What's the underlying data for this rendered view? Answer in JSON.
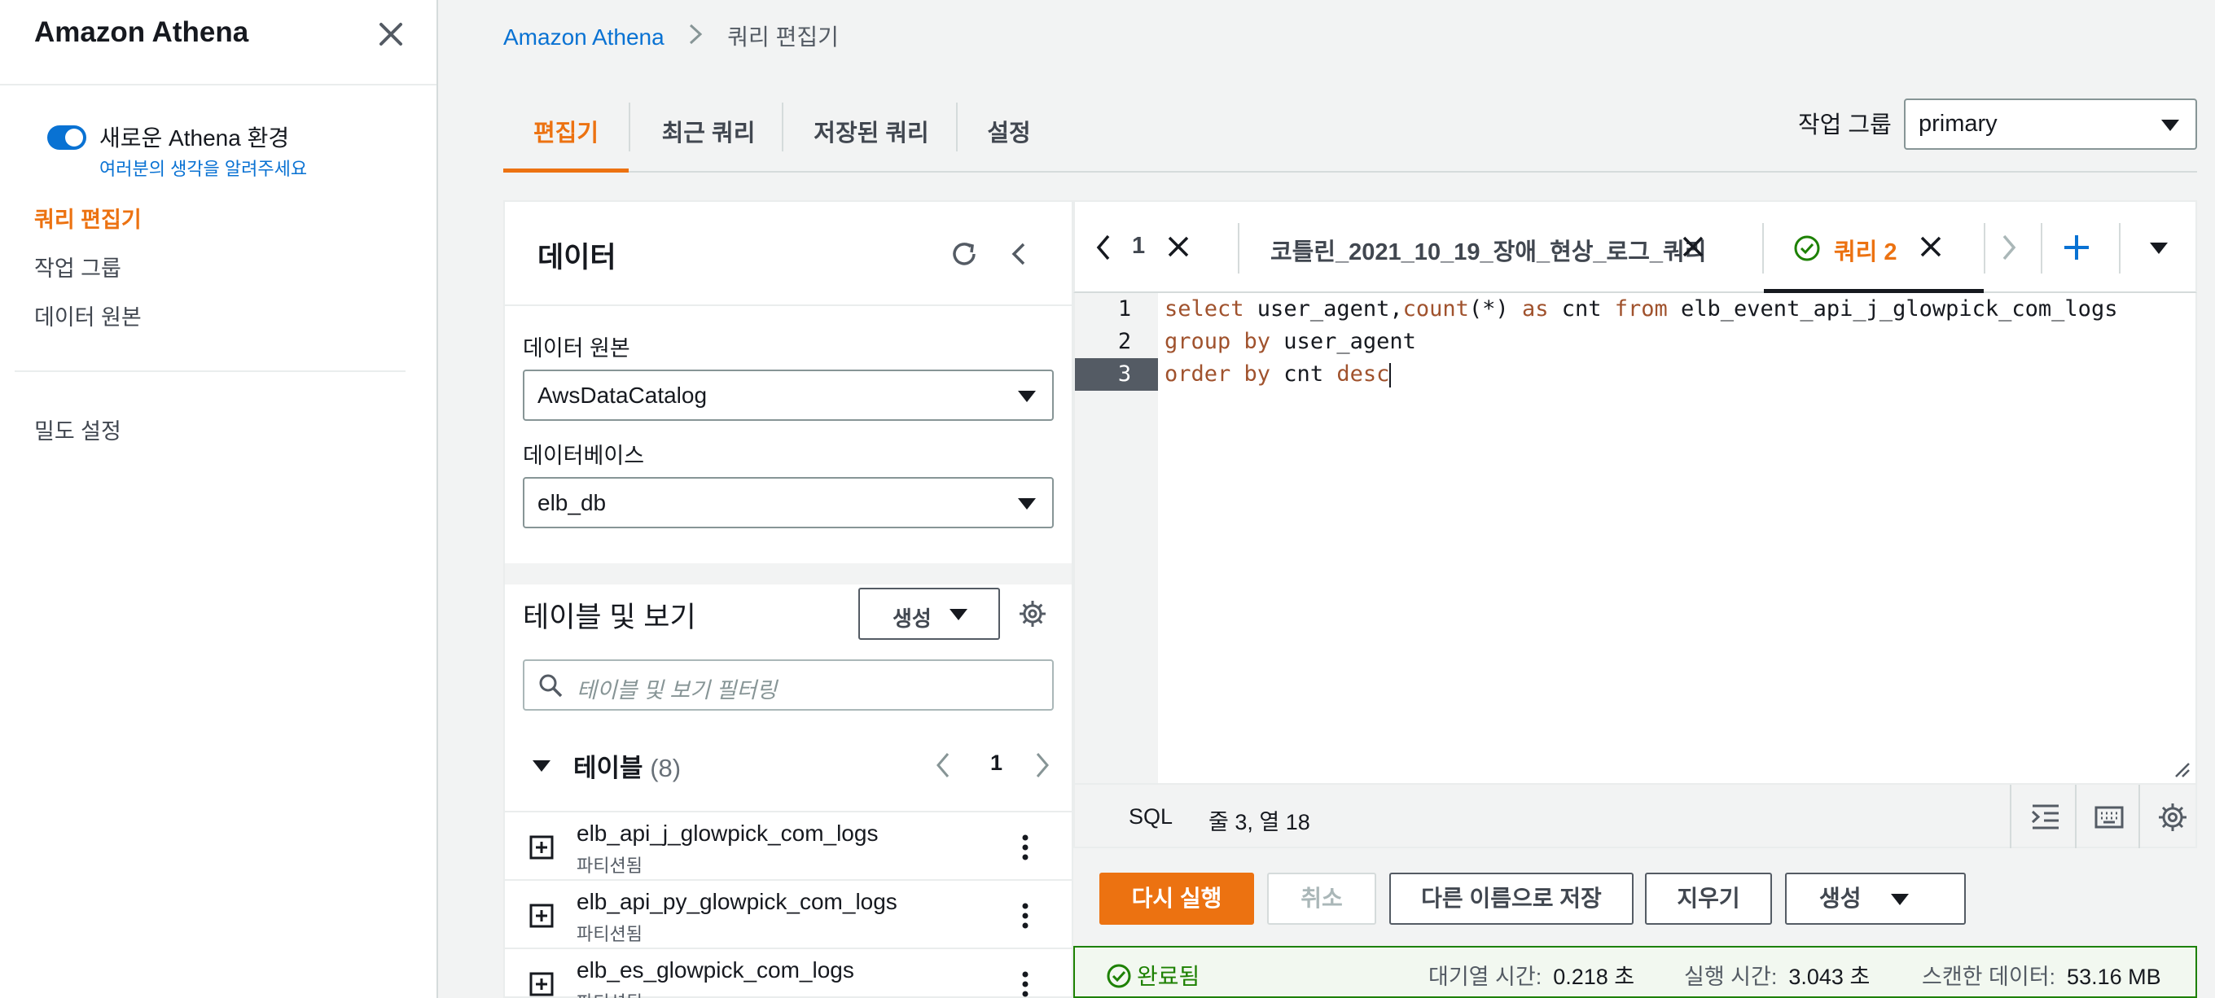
{
  "nav": {
    "title": "Amazon Athena",
    "toggle_label": "새로운 Athena 환경",
    "feedback_link": "여러분의 생각을 알려주세요",
    "items": [
      {
        "label": "쿼리 편집기",
        "active": true
      },
      {
        "label": "작업 그룹",
        "active": false
      },
      {
        "label": "데이터 원본",
        "active": false
      }
    ],
    "density_settings": "밀도 설정"
  },
  "breadcrumb": {
    "root": "Amazon Athena",
    "current": "쿼리 편집기"
  },
  "tabs": {
    "items": [
      "편집기",
      "최근 쿼리",
      "저장된 쿼리",
      "설정"
    ],
    "active_index": 0
  },
  "workgroup": {
    "label": "작업 그룹",
    "value": "primary"
  },
  "data_panel": {
    "title": "데이터",
    "data_source_label": "데이터 원본",
    "data_source_value": "AwsDataCatalog",
    "database_label": "데이터베이스",
    "database_value": "elb_db",
    "tables_views_title": "테이블 및 보기",
    "create_label": "생성",
    "filter_placeholder": "테이블 및 보기 필터링",
    "tables_label": "테이블",
    "tables_count": "(8)",
    "page": "1",
    "tables": [
      {
        "name": "elb_api_j_glowpick_com_logs",
        "sub": "파티션됨"
      },
      {
        "name": "elb_api_py_glowpick_com_logs",
        "sub": "파티션됨"
      },
      {
        "name": "elb_es_glowpick_com_logs",
        "sub": "파티션됨"
      }
    ]
  },
  "editor": {
    "tabs": [
      {
        "label": "1"
      },
      {
        "label": "코틀린_2021_10_19_장애_현상_로그_쿼리"
      },
      {
        "label": "쿼리 2",
        "active": true
      }
    ],
    "lines": [
      {
        "num": "1"
      },
      {
        "num": "2"
      },
      {
        "num": "3"
      }
    ],
    "code": {
      "l1_kw1": "select",
      "l1_t1": " user_agent,",
      "l1_kw2": "count",
      "l1_t2": "(*) ",
      "l1_kw3": "as",
      "l1_t3": " cnt ",
      "l1_kw4": "from",
      "l1_t4": " elb_event_api_j_glowpick_com_logs",
      "l2_kw1": "group by",
      "l2_t1": " user_agent",
      "l3_kw1": "order by",
      "l3_t1": " cnt ",
      "l3_kw2": "desc"
    },
    "language": "SQL",
    "cursor_position": "줄 3, 열 18"
  },
  "actions": {
    "run_again": "다시 실행",
    "cancel": "취소",
    "save_as": "다른 이름으로 저장",
    "clear": "지우기",
    "create": "생성"
  },
  "result": {
    "status": "완료됨",
    "queue_time_label": "대기열 시간:",
    "queue_time_value": "0.218 초",
    "run_time_label": "실행 시간:",
    "run_time_value": "3.043 초",
    "scanned_label": "스캔한 데이터:",
    "scanned_value": "53.16 MB"
  },
  "colors": {
    "accent": "#ec7211",
    "link": "#0972d3",
    "success": "#1d8102"
  }
}
